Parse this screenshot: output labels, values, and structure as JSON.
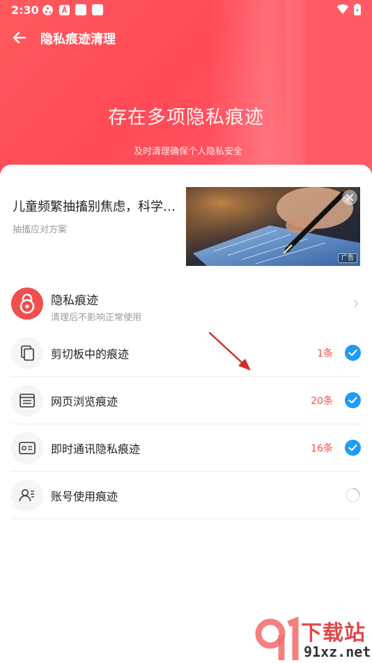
{
  "status_bar": {
    "time": "2:30"
  },
  "header": {
    "title": "隐私痕迹清理"
  },
  "hero": {
    "title": "存在多项隐私痕迹",
    "subtitle": "及时清理确保个人隐私安全"
  },
  "ad": {
    "title": "儿童频繁抽搐别焦虑，科学…",
    "subtitle": "抽搐应对方案",
    "tag": "广告"
  },
  "privacy": {
    "label": "隐私痕迹",
    "sub": "清理后不影响正常使用"
  },
  "items": [
    {
      "label": "剪切板中的痕迹",
      "count": "1条",
      "state": "checked",
      "icon": "clipboard-icon"
    },
    {
      "label": "网页浏览痕迹",
      "count": "20条",
      "state": "checked",
      "icon": "browser-icon"
    },
    {
      "label": "即时通讯隐私痕迹",
      "count": "16条",
      "state": "checked",
      "icon": "id-card-icon"
    },
    {
      "label": "账号使用痕迹",
      "count": "",
      "state": "loading",
      "icon": "account-icon"
    }
  ],
  "watermark": {
    "title": "下载站",
    "url": "91xz.net"
  },
  "colors": {
    "accent_red": "#ff4b57",
    "check_blue": "#1f9cf5",
    "count_red": "#f0524f"
  }
}
